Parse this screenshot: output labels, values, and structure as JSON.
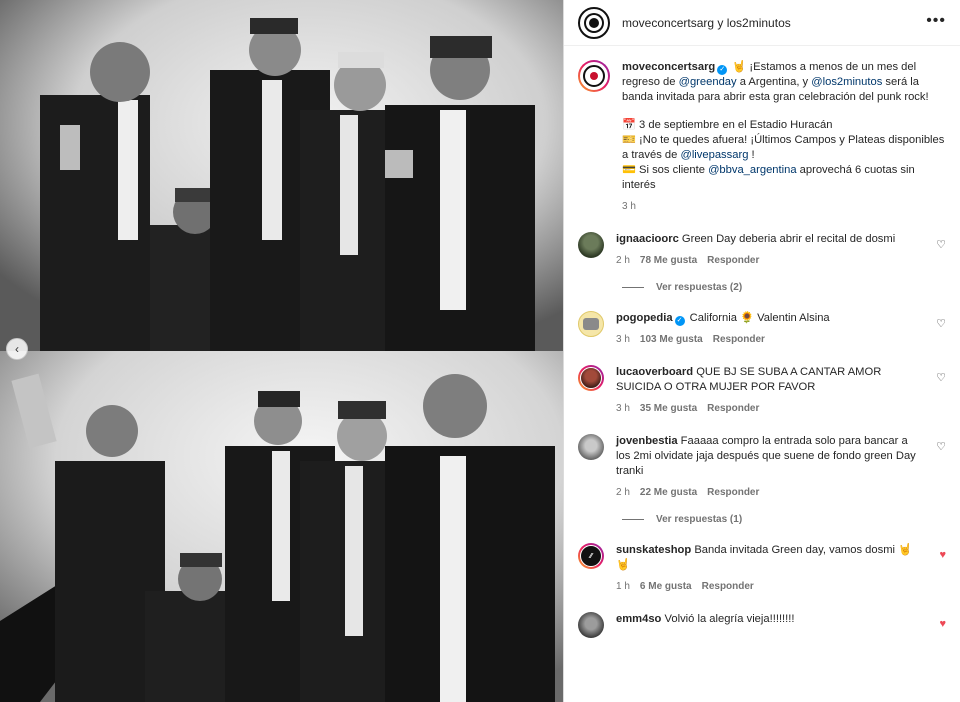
{
  "header": {
    "names": "moveconcertsarg y los2minutos"
  },
  "caption": {
    "username": "moveconcertsarg",
    "line1_a": " 🤘 ¡Estamos a menos de un mes del regreso de ",
    "mention_greenday": "@greenday",
    "line1_b": " a Argentina, y ",
    "mention_los2": "@los2minutos",
    "line1_c": " será la banda invitada para abrir esta gran celebración del punk rock!",
    "event_line": "📅 3 de septiembre en el Estadio Huracán",
    "tickets_line_a": "🎫 ¡No te quedes afuera! ¡Últimos Campos y Plateas disponibles a través de ",
    "mention_livepass": "@livepassarg",
    "tickets_line_b": " !",
    "bbva_line_a": "💳 Si sos cliente ",
    "mention_bbva": "@bbva_argentina",
    "bbva_line_b": " aprovechá 6 cuotas sin interés",
    "time": "3 h"
  },
  "comments": [
    {
      "username": "ignaacioorc",
      "text": "Green Day deberia abrir el recital de dosmi",
      "time": "2 h",
      "likes": "78 Me gusta",
      "reply": "Responder",
      "view_replies": "Ver respuestas (2)"
    },
    {
      "username": "pogopedia",
      "text": "California 🌻 Valentin Alsina",
      "time": "3 h",
      "likes": "103 Me gusta",
      "reply": "Responder"
    },
    {
      "username": "lucaoverboard",
      "text": "QUE BJ SE SUBA A CANTAR AMOR SUICIDA O OTRA MUJER POR FAVOR",
      "time": "3 h",
      "likes": "35 Me gusta",
      "reply": "Responder"
    },
    {
      "username": "jovenbestia",
      "text": "Faaaaa compro la entrada solo para bancar a los 2mi olvidate jaja después que suene de fondo green Day tranki",
      "time": "2 h",
      "likes": "22 Me gusta",
      "reply": "Responder",
      "view_replies": "Ver respuestas (1)"
    },
    {
      "username": "sunskateshop",
      "text": "Banda invitada Green day, vamos dosmi 🤘🤘",
      "time": "1 h",
      "likes": "6 Me gusta",
      "reply": "Responder"
    },
    {
      "username": "emm4so",
      "text": "Volvió la alegría vieja!!!!!!!!"
    }
  ],
  "icons": {
    "heart": "♡",
    "heart_filled": "♥",
    "more": "•••",
    "prev": "‹"
  },
  "colors": {
    "mention": "#00376b",
    "verified": "#0095f6",
    "liked": "#ed4956"
  }
}
